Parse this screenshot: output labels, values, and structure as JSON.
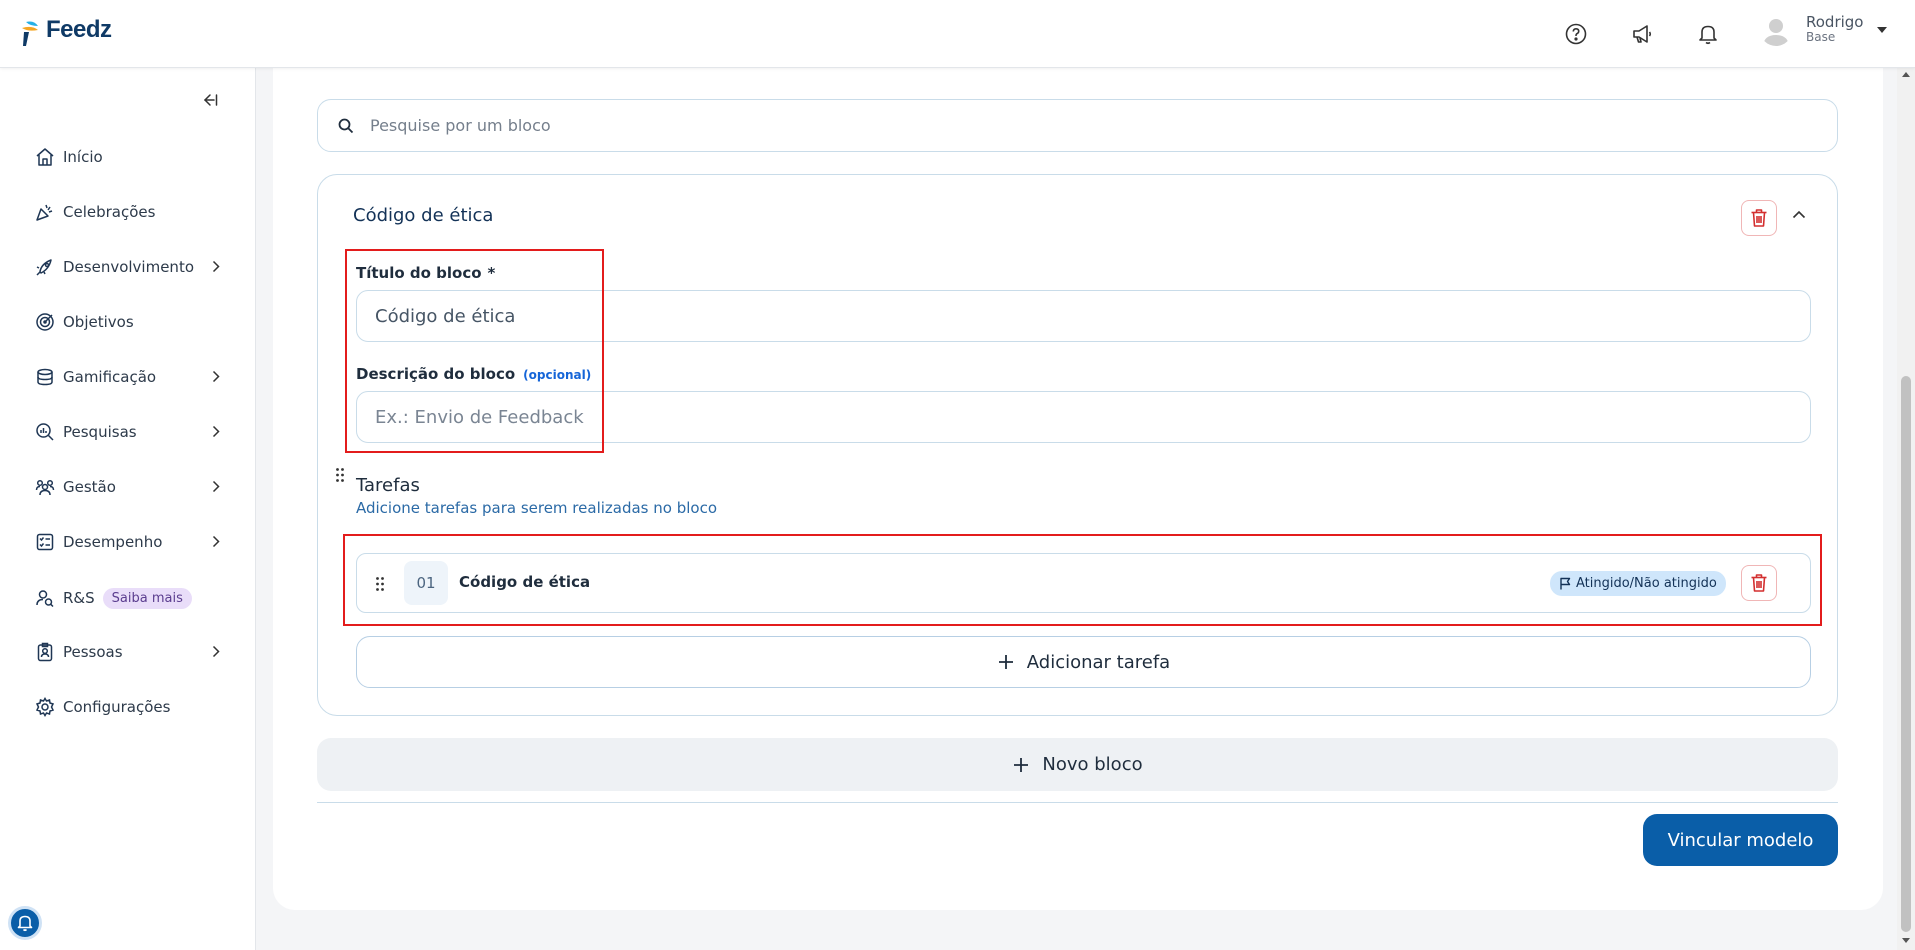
{
  "app": {
    "logo_text": "Feedz"
  },
  "header": {
    "user_name": "Rodrigo",
    "user_role": "Base",
    "icons": [
      "help-circle-icon",
      "megaphone-icon",
      "bell-icon",
      "user-avatar-icon",
      "caret-down-icon"
    ]
  },
  "sidebar": {
    "items": [
      {
        "label": "Início",
        "icon": "home-icon"
      },
      {
        "label": "Celebrações",
        "icon": "party-icon"
      },
      {
        "label": "Desenvolvimento",
        "icon": "rocket-icon",
        "has_submenu": true
      },
      {
        "label": "Objetivos",
        "icon": "target-icon"
      },
      {
        "label": "Gamificação",
        "icon": "coins-icon",
        "has_submenu": true
      },
      {
        "label": "Pesquisas",
        "icon": "search-chart-icon",
        "has_submenu": true
      },
      {
        "label": "Gestão",
        "icon": "users-icon",
        "has_submenu": true
      },
      {
        "label": "Desempenho",
        "icon": "checklist-icon",
        "has_submenu": true
      },
      {
        "label": "R&S",
        "icon": "user-search-icon",
        "badge": "Saiba mais"
      },
      {
        "label": "Pessoas",
        "icon": "badge-icon",
        "has_submenu": true
      },
      {
        "label": "Configurações",
        "icon": "gear-icon"
      }
    ]
  },
  "search": {
    "placeholder": "Pesquise por um bloco"
  },
  "block": {
    "title": "Código de ética",
    "title_label": "Título do bloco",
    "required_mark": "*",
    "title_value": "Código de ética",
    "description_label": "Descrição do bloco",
    "optional_label": "(opcional)",
    "description_placeholder": "Ex.: Envio de Feedback",
    "tasks_title": "Tarefas",
    "tasks_subtitle": "Adicione tarefas para serem realizadas no bloco",
    "tasks": [
      {
        "number": "01",
        "name": "Código de ética",
        "badge": "Atingido/Não atingido"
      }
    ],
    "add_task_label": "Adicionar tarefa"
  },
  "actions": {
    "new_block_label": "Novo bloco",
    "link_model_label": "Vincular modelo"
  },
  "colors": {
    "primary": "#0a5ea8",
    "danger": "#d32f2f",
    "highlight": "#e31c1c",
    "badge_bg": "#cfe6fb"
  }
}
